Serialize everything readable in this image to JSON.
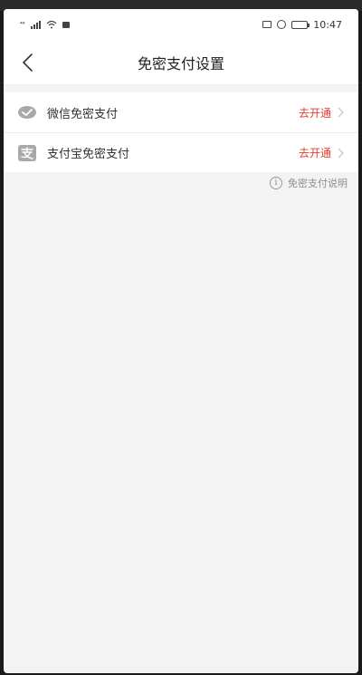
{
  "status_bar": {
    "left_text": "⁴⁶",
    "time": "10:47"
  },
  "nav": {
    "title": "免密支付设置"
  },
  "list": [
    {
      "label": "微信免密支付",
      "action": "去开通",
      "icon": "wechat-icon"
    },
    {
      "label": "支付宝免密支付",
      "action": "去开通",
      "icon": "alipay-icon"
    }
  ],
  "footer_note": "免密支付说明",
  "colors": {
    "accent": "#e33b2e",
    "background": "#f3f3f3"
  }
}
